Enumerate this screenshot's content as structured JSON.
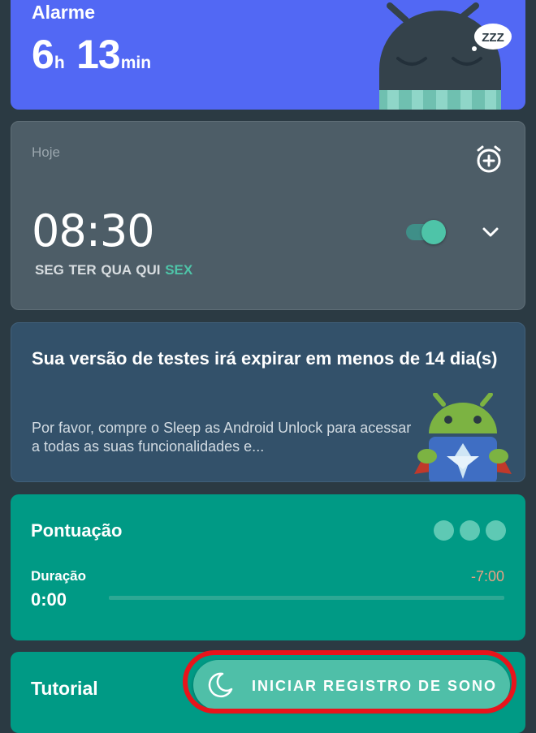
{
  "header": {
    "title": "Alarme",
    "hours": "6",
    "hours_unit": "h",
    "minutes": "13",
    "minutes_unit": "min",
    "mascot_text": "ZZZ"
  },
  "alarm": {
    "day": "Hoje",
    "time": "08:30",
    "days_regular": "SEG TER QUA QUI",
    "days_highlight": "SEX",
    "enabled": true
  },
  "trial": {
    "title": "Sua versão de testes irá expirar em menos de 14 dia(s)",
    "body": "Por favor, compre o Sleep as Android Unlock para acessar a todas as suas funcionalidades e..."
  },
  "score": {
    "title": "Pontuação",
    "duration_label": "Duração",
    "duration_value": "0:00",
    "duration_target": "-7:00"
  },
  "tutorial": {
    "title": "Tutorial"
  },
  "fab": {
    "label": "INICIAR REGISTRO DE SONO",
    "icon": "moon-icon"
  },
  "colors": {
    "background": "#2b3a43",
    "header": "#5268f4",
    "alarm_card": "#4d5d67",
    "trial_card": "#33516a",
    "teal": "#009a85",
    "accent": "#4ec4a8",
    "highlight_ring": "#e8141b"
  }
}
